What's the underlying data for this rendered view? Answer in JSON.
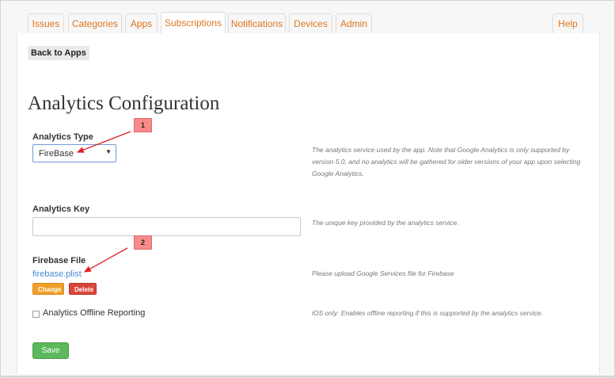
{
  "tabs": {
    "issues": "Issues",
    "categories": "Categories",
    "apps": "Apps",
    "subscriptions": "Subscriptions",
    "notifications": "Notifications",
    "devices": "Devices",
    "admin": "Admin",
    "help": "Help",
    "active": "Subscriptions"
  },
  "back_button": "Back to Apps",
  "page_title": "Analytics Configuration",
  "analytics_type": {
    "label": "Analytics Type",
    "selected": "FireBase",
    "help": "The analytics service used by the app. Note that Google Analytics is only supported by version 5.0, and no analytics will be gathered for older versions of your app upon selecting Google Analytics."
  },
  "analytics_key": {
    "label": "Analytics Key",
    "value": "",
    "help": "The unique key provided by the analytics service."
  },
  "firebase_file": {
    "label": "Firebase File",
    "filename": "firebase.plist",
    "change_label": "Change",
    "delete_label": "Delete",
    "help": "Please upload Google Services file for Firebase"
  },
  "offline_reporting": {
    "label": "Analytics Offline Reporting",
    "checked": false,
    "help": "iOS only: Enables offline reporting if this is supported by the analytics service."
  },
  "save_label": "Save",
  "callouts": [
    "1",
    "2"
  ],
  "colors": {
    "tab_text": "#e0761d",
    "link": "#4a8ad0",
    "change_button": "#f0a028",
    "delete_button": "#d9463a",
    "save_button": "#5cb85c",
    "callout": "#f88a8a",
    "arrow": "#e0202a"
  }
}
